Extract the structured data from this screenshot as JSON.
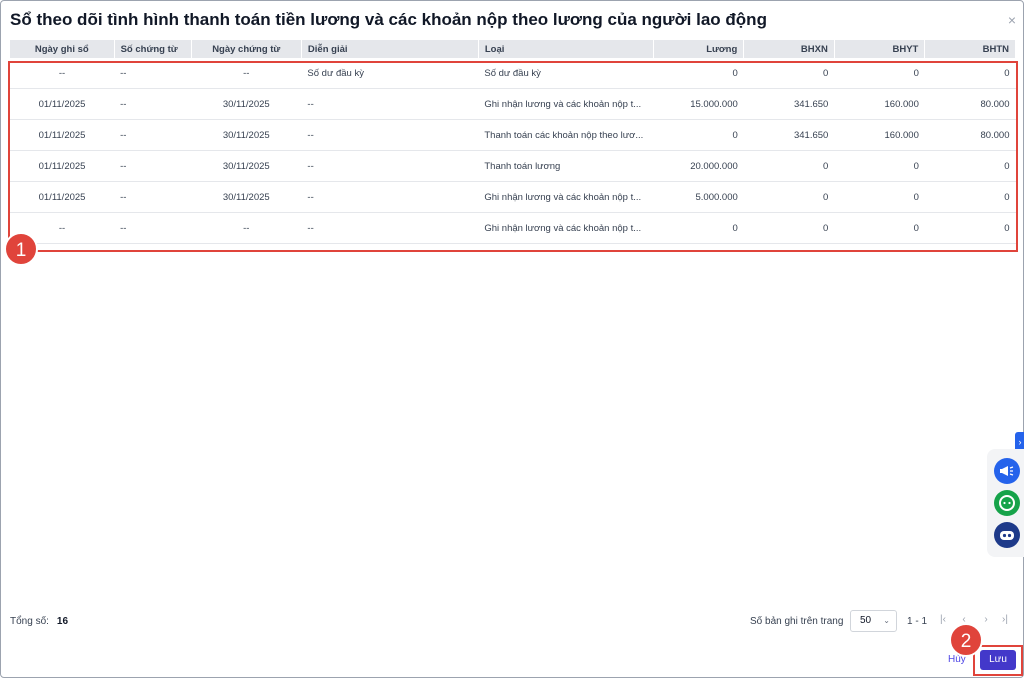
{
  "dialog": {
    "title": "Sổ theo dõi tình hình thanh toán tiền lương và các khoản nộp theo lương của người lao động",
    "close_icon": "×"
  },
  "table": {
    "columns": [
      "Ngày ghi sổ",
      "Số chứng từ",
      "Ngày chứng từ",
      "Diễn giải",
      "Loại",
      "Lương",
      "BHXN",
      "BHYT",
      "BHTN"
    ],
    "rows": [
      [
        "--",
        "--",
        "--",
        "Số dư đầu kỳ",
        "Số dư đầu kỳ",
        "0",
        "0",
        "0",
        "0"
      ],
      [
        "01/11/2025",
        "--",
        "30/11/2025",
        "--",
        "Ghi nhận lương và các khoản nộp t...",
        "15.000.000",
        "341.650",
        "160.000",
        "80.000"
      ],
      [
        "01/11/2025",
        "--",
        "30/11/2025",
        "--",
        "Thanh toán các khoản nộp theo lươ...",
        "0",
        "341.650",
        "160.000",
        "80.000"
      ],
      [
        "01/11/2025",
        "--",
        "30/11/2025",
        "--",
        "Thanh toán lương",
        "20.000.000",
        "0",
        "0",
        "0"
      ],
      [
        "01/11/2025",
        "--",
        "30/11/2025",
        "--",
        "Ghi nhận lương và các khoản nộp t...",
        "5.000.000",
        "0",
        "0",
        "0"
      ],
      [
        "--",
        "--",
        "--",
        "--",
        "Ghi nhận lương và các khoản nộp t...",
        "0",
        "0",
        "0",
        "0"
      ]
    ]
  },
  "annotations": {
    "badge_1": "1",
    "badge_2": "2",
    "highlight_color": "#e0443b"
  },
  "footer": {
    "total_label": "Tổng số:",
    "total_value": "16",
    "per_page_label": "Số bản ghi trên trang",
    "per_page_value": "50",
    "range": "1 - 1",
    "pager_icons": [
      "first-page-icon",
      "prev-page-icon",
      "next-page-icon",
      "last-page-icon"
    ]
  },
  "actions": {
    "cancel": "Hủy",
    "save": "Lưu",
    "accent": "#4338ca"
  },
  "side_widgets": [
    "megaphone-icon",
    "chat-icon",
    "robot-icon"
  ]
}
